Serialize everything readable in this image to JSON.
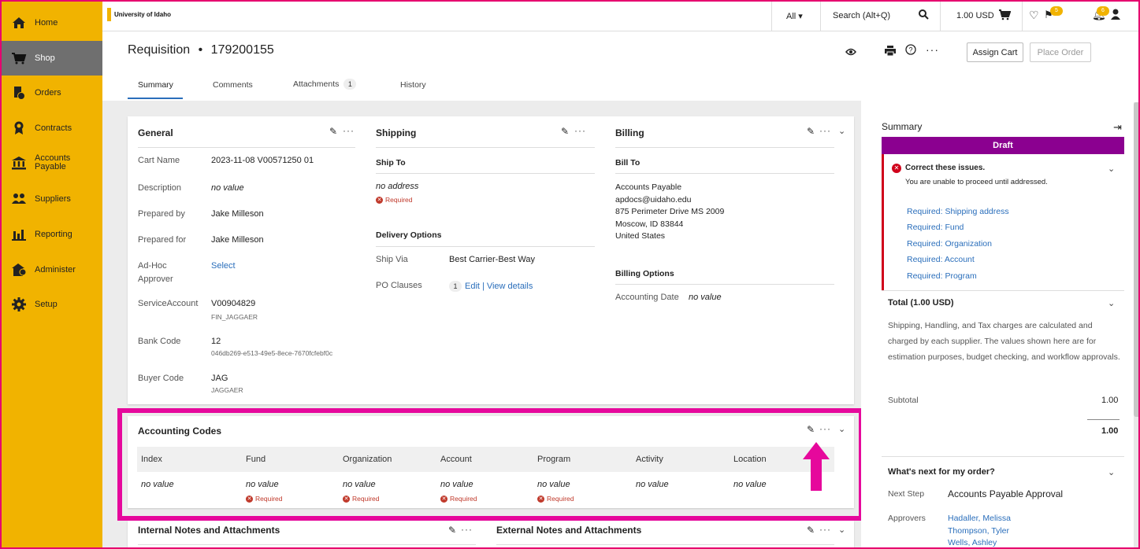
{
  "sidebar": {
    "items": [
      {
        "label": "Home",
        "icon": "home-icon"
      },
      {
        "label": "Shop",
        "icon": "cart-icon"
      },
      {
        "label": "Orders",
        "icon": "orders-icon"
      },
      {
        "label": "Contracts",
        "icon": "contracts-icon"
      },
      {
        "label": "Accounts Payable",
        "label1": "Accounts",
        "label2": "Payable",
        "icon": "bank-icon"
      },
      {
        "label": "Suppliers",
        "icon": "suppliers-icon"
      },
      {
        "label": "Reporting",
        "icon": "chart-icon"
      },
      {
        "label": "Administer",
        "icon": "administer-icon"
      },
      {
        "label": "Setup",
        "icon": "gear-icon"
      }
    ],
    "active": "Shop",
    "color": "#f1b300"
  },
  "topbar": {
    "logo_text": "University of Idaho",
    "filter_label": "All",
    "search_placeholder": "Search (Alt+Q)",
    "cart_total": "1.00 USD",
    "flag_count": "5",
    "notification_count": "6"
  },
  "header": {
    "title": "Requisition",
    "separator": "•",
    "req_number": "179200155",
    "assign_cart": "Assign Cart",
    "place_order": "Place Order",
    "tabs": [
      {
        "label": "Summary"
      },
      {
        "label": "Comments"
      },
      {
        "label": "Attachments",
        "count": "1"
      },
      {
        "label": "History"
      }
    ]
  },
  "general": {
    "title": "General",
    "rows": [
      {
        "label": "Cart Name",
        "value": "2023-11-08 V00571250 01"
      },
      {
        "label": "Description",
        "value": "no value"
      },
      {
        "label": "Prepared by",
        "value": "Jake Milleson"
      },
      {
        "label": "Prepared for",
        "value": "Jake Milleson"
      },
      {
        "label": "Ad-Hoc",
        "label2": "Approver",
        "value": "Select"
      },
      {
        "label": "ServiceAccount",
        "value": "V00904829",
        "sub": "FIN_JAGGAER"
      },
      {
        "label": "Bank Code",
        "value": "12",
        "sub": "046db269-e513-49e5-8ece-7670fcfebf0c"
      },
      {
        "label": "Buyer Code",
        "value": "JAG",
        "sub": "JAGGAER"
      }
    ]
  },
  "shipping": {
    "title": "Shipping",
    "ship_to": "Ship To",
    "address": "no address",
    "required": "Required",
    "delivery_options": "Delivery Options",
    "ship_via_label": "Ship Via",
    "ship_via_value": "Best Carrier-Best Way",
    "po_clauses_label": "PO Clauses",
    "po_clauses_count": "1",
    "edit": "Edit",
    "divider": "|",
    "view_details": "View details"
  },
  "billing": {
    "title": "Billing",
    "bill_to": "Bill To",
    "address_lines": [
      "Accounts Payable",
      "apdocs@uidaho.edu",
      "875 Perimeter Drive MS 2009",
      "Moscow, ID 83844",
      "United States"
    ],
    "billing_options": "Billing Options",
    "accounting_date_label": "Accounting Date",
    "accounting_date_value": "no value"
  },
  "accounting": {
    "title": "Accounting Codes",
    "columns": [
      "Index",
      "Fund",
      "Organization",
      "Account",
      "Program",
      "Activity",
      "Location"
    ],
    "values": [
      "no value",
      "no value",
      "no value",
      "no value",
      "no value",
      "no value",
      "no value"
    ],
    "required_flags": [
      false,
      true,
      true,
      true,
      true,
      false,
      false
    ],
    "required": "Required"
  },
  "notes": {
    "internal": "Internal Notes and Attachments",
    "external": "External Notes and Attachments"
  },
  "summary_panel": {
    "title": "Summary",
    "status": "Draft",
    "status_color": "#8b0090",
    "issues_title": "Correct these issues.",
    "issues_sub": "You are unable to proceed until addressed.",
    "issues": [
      "Required: Shipping address",
      "Required: Fund",
      "Required: Organization",
      "Required: Account",
      "Required: Program"
    ],
    "total_title": "Total (1.00 USD)",
    "total_desc": "Shipping, Handling, and Tax charges are calculated and charged by each supplier. The values shown here are for estimation purposes, budget checking, and workflow approvals.",
    "subtotal_label": "Subtotal",
    "subtotal_value": "1.00",
    "total_value": "1.00",
    "next_title": "What's next for my order?",
    "next_step_label": "Next Step",
    "next_step_value": "Accounts Payable Approval",
    "approvers_label": "Approvers",
    "approvers": [
      "Hadaller, Melissa",
      "Thompson, Tyler",
      "Wells, Ashley"
    ]
  },
  "highlight_color": "#e6089c"
}
